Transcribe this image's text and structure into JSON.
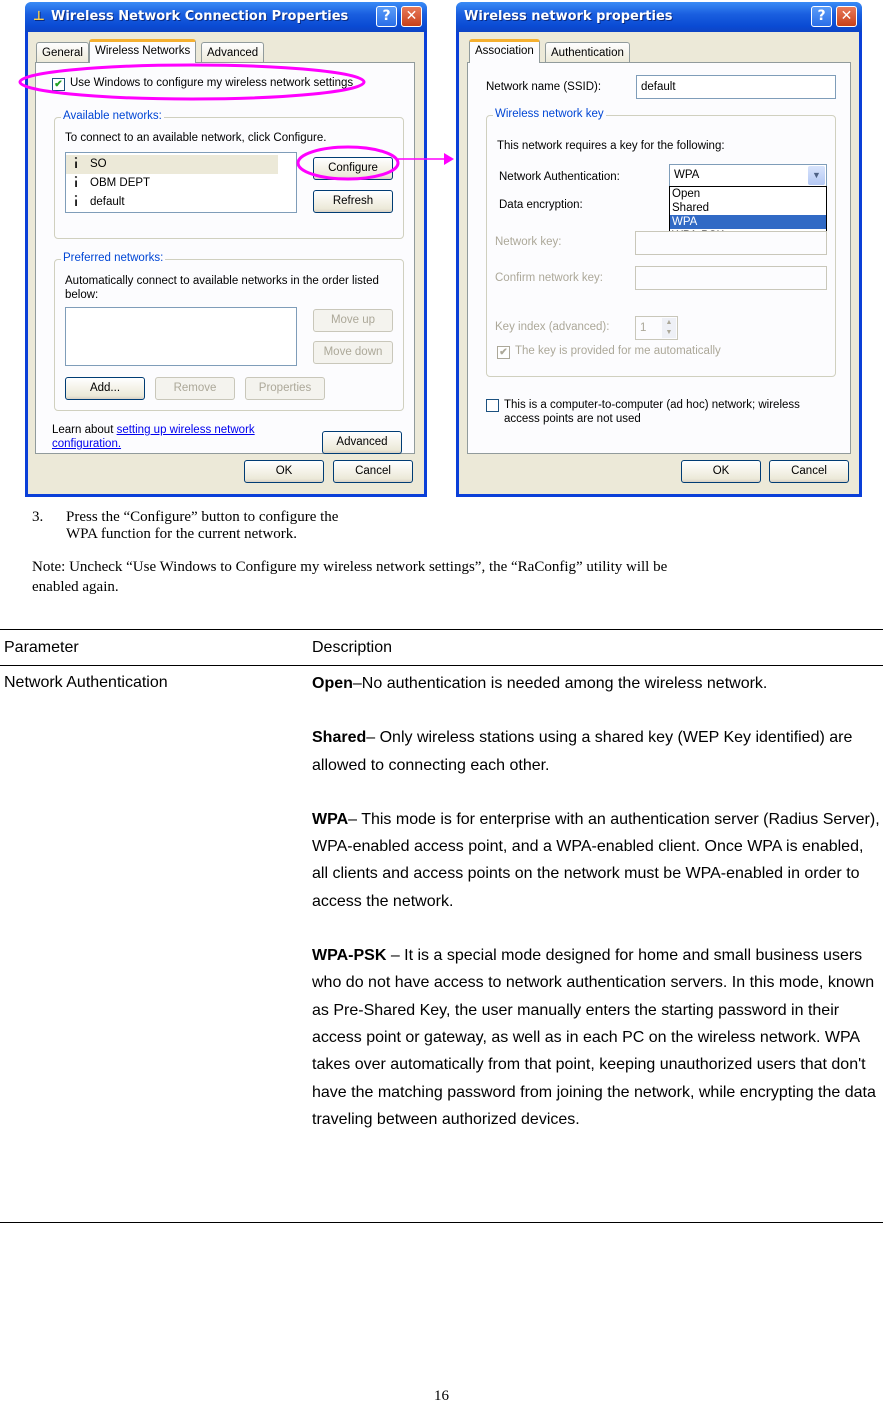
{
  "left_dialog": {
    "title": "Wireless Network Connection Properties",
    "title_icon": "network-connection-icon",
    "help_label": "?",
    "close_label": "✕",
    "tabs": [
      {
        "label": "General",
        "active": false
      },
      {
        "label": "Wireless Networks",
        "active": true
      },
      {
        "label": "Advanced",
        "active": false
      }
    ],
    "use_windows_checkbox": {
      "label": "Use Windows to configure my wireless network settings",
      "checked": true,
      "check_glyph": "✔"
    },
    "available_networks": {
      "title": "Available networks:",
      "instruction": "To connect to an available network, click Configure.",
      "networks": [
        {
          "name": "SO",
          "icon": "antenna-icon",
          "selected": true
        },
        {
          "name": "OBM DEPT",
          "icon": "antenna-icon",
          "selected": false
        },
        {
          "name": "default",
          "icon": "antenna-icon",
          "selected": false
        }
      ],
      "configure_label": "Configure",
      "refresh_label": "Refresh"
    },
    "preferred_networks": {
      "title": "Preferred networks:",
      "instruction": "Automatically connect to available networks in the order listed below:",
      "move_up_label": "Move up",
      "move_down_label": "Move down",
      "add_label": "Add...",
      "remove_label": "Remove",
      "properties_label": "Properties"
    },
    "learn_about_prefix": "Learn about ",
    "learn_about_link_line1": "setting up wireless network",
    "learn_about_link_line2": "configuration.",
    "advanced_label": "Advanced",
    "ok_label": "OK",
    "cancel_label": "Cancel"
  },
  "right_dialog": {
    "title": "Wireless network properties",
    "help_label": "?",
    "close_label": "✕",
    "tabs": [
      {
        "label": "Association",
        "active": true
      },
      {
        "label": "Authentication",
        "active": false
      }
    ],
    "ssid_label": "Network name (SSID):",
    "ssid_value": "default",
    "network_key_group": {
      "title": "Wireless network key",
      "instruction": "This network requires a key for the following:",
      "auth_label": "Network Authentication:",
      "auth_value": "WPA",
      "auth_options": [
        "Open",
        "Shared",
        "WPA",
        "WPA-PSK"
      ],
      "auth_highlighted": "WPA",
      "encryption_label": "Data encryption:",
      "network_key_label": "Network key:",
      "confirm_key_label": "Confirm network key:",
      "key_index_label": "Key index (advanced):",
      "key_index_value": "1",
      "auto_key_checkbox": {
        "label": "The key is provided for me automatically",
        "checked": true,
        "check_glyph": "✔"
      }
    },
    "adhoc_checkbox": {
      "label_line1": "This is a computer-to-computer (ad hoc) network; wireless",
      "label_line2": "access points are not used",
      "checked": false
    },
    "ok_label": "OK",
    "cancel_label": "Cancel"
  },
  "annotation": {
    "color": "#ff00ff"
  },
  "step": {
    "number": "3.",
    "line1": "Press the “Configure” button to configure the",
    "line2": "WPA function for the current network."
  },
  "note": {
    "line1": "Note: Uncheck “Use Windows to Configure my wireless  network settings”, the “RaConfig” utility will be",
    "line2": "enabled again."
  },
  "table": {
    "headers": [
      "Parameter",
      "Description"
    ],
    "rows": [
      {
        "parameter": "Network Authentication",
        "descriptions": [
          {
            "term": "Open",
            "text": "–No authentication is needed among the wireless network."
          },
          {
            "term": "Shared",
            "text": "– Only wireless stations using a shared key (WEP Key identified) are allowed to connecting each other."
          },
          {
            "term": "WPA",
            "text": "– This mode is for enterprise with an authentication server (Radius Server), WPA-enabled access point, and a WPA-enabled client. Once WPA is enabled, all clients and access points on the network must be WPA-enabled in order to access the network."
          },
          {
            "term": "WPA-PSK",
            "text": " – It is a special mode designed for home and small business users who do not have access to network authentication servers. In this mode, known as Pre-Shared Key, the user manually enters the starting password in their access point or gateway, as well as in each PC on the wireless network. WPA takes over automatically from that point, keeping unauthorized users that don't have the matching password from joining the network, while encrypting the data traveling between authorized devices."
          }
        ]
      }
    ]
  },
  "page_number": "16"
}
